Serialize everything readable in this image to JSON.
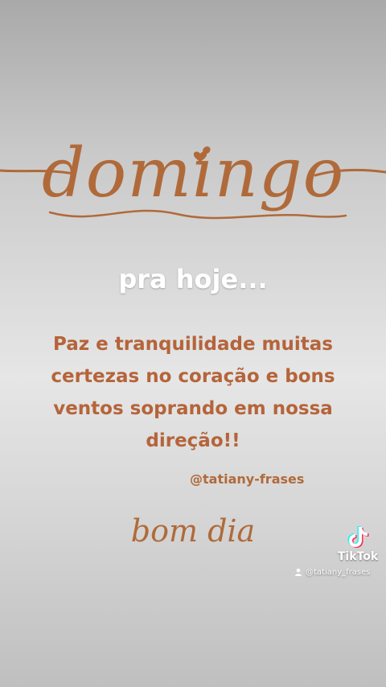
{
  "title": "domingo",
  "subtitle": "pra hoje...",
  "message": "Paz e tranquilidade muitas certezas no coração e bons ventos soprando em nossa direção!!",
  "handle": "@tatiany-frases",
  "closing": "bom dia",
  "watermark": {
    "brand": "TikTok",
    "username": "@tatiany_frases",
    "icon": "tiktok-note-icon"
  },
  "colors": {
    "accent": "#b06a3a",
    "subtitle": "#ffffff"
  }
}
